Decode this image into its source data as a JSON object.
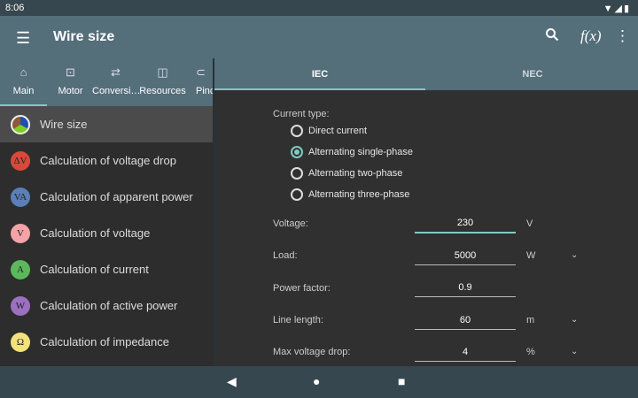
{
  "status": {
    "time": "8:06",
    "icons": [
      "wifi-icon",
      "signal-icon",
      "battery-icon"
    ]
  },
  "appbar": {
    "title": "Wire size",
    "actions": [
      "search-icon",
      "formula-icon",
      "more-icon"
    ],
    "formula_label": "f(x)"
  },
  "left_tabs": [
    {
      "label": "Main",
      "icon": "home-icon"
    },
    {
      "label": "Motor",
      "icon": "motor-icon"
    },
    {
      "label": "Conversi…",
      "icon": "repeat-icon"
    },
    {
      "label": "Resources",
      "icon": "table-icon"
    },
    {
      "label": "Pinc",
      "icon": "plug-icon"
    }
  ],
  "sidebar": {
    "items": [
      {
        "label": "Wire size",
        "badge": "",
        "color": "#8a5a3a"
      },
      {
        "label": "Calculation of voltage drop",
        "badge": "ΔV",
        "color": "#d9483b"
      },
      {
        "label": "Calculation of apparent power",
        "badge": "VA",
        "color": "#5b7fb8"
      },
      {
        "label": "Calculation of voltage",
        "badge": "V",
        "color": "#f4a3a8"
      },
      {
        "label": "Calculation of current",
        "badge": "A",
        "color": "#5cb85c"
      },
      {
        "label": "Calculation of active power",
        "badge": "W",
        "color": "#9b70c0"
      },
      {
        "label": "Calculation of impedance",
        "badge": "Ω",
        "color": "#f2e27a"
      }
    ]
  },
  "right_tabs": [
    "IEC",
    "NEC"
  ],
  "form": {
    "current_type_label": "Current type:",
    "current_types": [
      "Direct current",
      "Alternating single-phase",
      "Alternating two-phase",
      "Alternating three-phase"
    ],
    "selected_current_type": 1,
    "fields": [
      {
        "label": "Voltage:",
        "value": "230",
        "unit": "V",
        "dropdown": false
      },
      {
        "label": "Load:",
        "value": "5000",
        "unit": "W",
        "dropdown": true
      },
      {
        "label": "Power factor:",
        "value": "0.9",
        "unit": "",
        "dropdown": false
      },
      {
        "label": "Line length:",
        "value": "60",
        "unit": "m",
        "dropdown": true
      },
      {
        "label": "Max voltage drop:",
        "value": "4",
        "unit": "%",
        "dropdown": true
      }
    ]
  },
  "colors": {
    "accent": "#80cbc4",
    "appbar": "#546e7a",
    "statusbar": "#37474f"
  }
}
